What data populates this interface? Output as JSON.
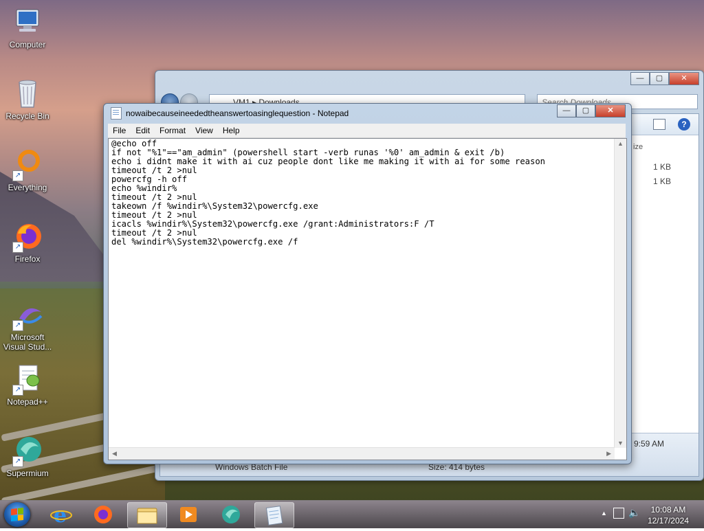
{
  "desktop": {
    "icons": [
      {
        "label": "Computer"
      },
      {
        "label": "Recycle Bin"
      },
      {
        "label": "Everything"
      },
      {
        "label": "Firefox"
      },
      {
        "label": "Microsoft Visual Stud..."
      },
      {
        "label": "Notepad++"
      },
      {
        "label": "Supermium"
      }
    ]
  },
  "explorer": {
    "path": "VM1 ▸ Downloads",
    "search_placeholder": "Search Downloads",
    "size_header": "ize",
    "files": [
      {
        "size": "1 KB"
      },
      {
        "size": "1 KB"
      }
    ],
    "details_time": "9:59 AM",
    "details_name": "Windows Batch File",
    "details_size": "Size: 414 bytes"
  },
  "notepad": {
    "title": "nowaibecauseineededtheanswertoasinglequestion - Notepad",
    "menu": [
      "File",
      "Edit",
      "Format",
      "View",
      "Help"
    ],
    "content": "@echo off\nif not \"%1\"==\"am_admin\" (powershell start -verb runas '%0' am_admin & exit /b)\necho i didnt make it with ai cuz people dont like me making it with ai for some reason\ntimeout /t 2 >nul\npowercfg -h off\necho %windir%\ntimeout /t 2 >nul\ntakeown /f %windir%\\System32\\powercfg.exe\ntimeout /t 2 >nul\nicacls %windir%\\System32\\powercfg.exe /grant:Administrators:F /T\ntimeout /t 2 >nul\ndel %windir%\\System32\\powercfg.exe /f"
  },
  "taskbar": {
    "time": "10:08 AM",
    "date": "12/17/2024"
  },
  "colors": {
    "taskbar": "#3c373c",
    "window_frame": "#c3d4e7",
    "close_button": "#c7402b"
  }
}
